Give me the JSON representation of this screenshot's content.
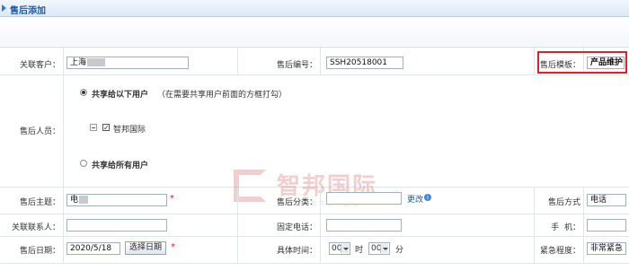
{
  "header": {
    "title": "售后添加"
  },
  "row1": {
    "customer_label": "关联客户：",
    "customer_value": "上海",
    "number_label": "售后编号：",
    "number_value": "SSH20518001",
    "template_label": "售后模板：",
    "template_value": "产品维护"
  },
  "personnel": {
    "label": "售后人员：",
    "option_share_selected": "共享给以下用户",
    "option_share_hint": "（在需要共享用户前面的方框打勾）",
    "tree_node": "智邦国际",
    "option_share_all": "共享给所有用户"
  },
  "watermark": {
    "brand": "智邦国际",
    "slogan": "企业管理软件领导品牌"
  },
  "row_subject": {
    "subject_label": "售后主题：",
    "subject_value": "电",
    "category_label": "售后分类：",
    "change_link": "更改",
    "method_label": "售后方式",
    "method_value": "电话"
  },
  "row_contact": {
    "contact_label": "关联联系人：",
    "phone_label": "固定电话：",
    "mobile_label": "手  机："
  },
  "row_date": {
    "date_label": "售后日期：",
    "date_value": "2020/5/18",
    "pick_date_button": "选择日期",
    "time_label": "具体时间：",
    "hour_value": "00",
    "hour_unit": "时",
    "minute_value": "00",
    "minute_unit": "分",
    "urgency_label": "紧急程度：",
    "urgency_value": "非常紧急"
  },
  "required_mark": "*",
  "colors": {
    "title": "#1d5aa6",
    "required": "#d4202a",
    "highlight": "#e0202a"
  }
}
